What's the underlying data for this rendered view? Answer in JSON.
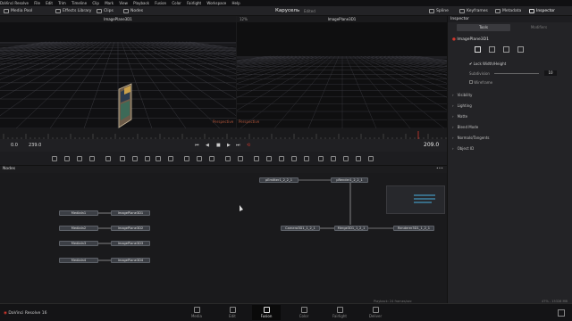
{
  "menubar": [
    "DaVinci Resolve",
    "File",
    "Edit",
    "Trim",
    "Timeline",
    "Clip",
    "Mark",
    "View",
    "Playback",
    "Fusion",
    "Color",
    "Fairlight",
    "Workspace",
    "Help"
  ],
  "toolbar": {
    "media_pool": "Media Pool",
    "effects_library": "Effects Library",
    "clips": "Clips",
    "nodes": "Nodes",
    "project_title": "Карусель",
    "project_status": "Edited",
    "spline": "Spline",
    "keyframes": "Keyframes",
    "metadata": "Metadata",
    "inspector": "Inspector"
  },
  "viewer_left": {
    "title": "ImagePlane3D1",
    "zoom": "",
    "view_label": "Perspective"
  },
  "viewer_right": {
    "title": "ImagePlane3D1",
    "zoom": "12%",
    "view_label": "Perspective"
  },
  "transport": {
    "start": "0.0",
    "end": "239.0",
    "current": "209.0"
  },
  "nodes_panel": {
    "title": "Nodes",
    "nodes": [
      {
        "id": "media1",
        "label": "MediaIn1"
      },
      {
        "id": "media2",
        "label": "MediaIn2"
      },
      {
        "id": "media3",
        "label": "MediaIn3"
      },
      {
        "id": "media4",
        "label": "MediaIn4"
      },
      {
        "id": "ip1",
        "label": "ImagePlane3D1"
      },
      {
        "id": "ip2",
        "label": "ImagePlane3D2"
      },
      {
        "id": "ip3",
        "label": "ImagePlane3D3"
      },
      {
        "id": "ip4",
        "label": "ImagePlane3D4"
      },
      {
        "id": "pem1",
        "label": "pEmitter1_2_2_1"
      },
      {
        "id": "prend",
        "label": "pRender1_2_2_1"
      },
      {
        "id": "cam",
        "label": "Camera3D1_1_2_1"
      },
      {
        "id": "merge",
        "label": "Merge3D1_1_2_1"
      },
      {
        "id": "renderer",
        "label": "Renderer3D1_1_2_1"
      }
    ]
  },
  "inspector": {
    "node_title": "ImagePlane3D1",
    "tabs": [
      "Tools",
      "Modifiers"
    ],
    "lock_label": "Lock Width/Height",
    "subdivision_label": "Subdivision",
    "subdivision_value": "10",
    "wireframe_label": "Wireframe",
    "sections": [
      "Visibility",
      "Lighting",
      "Matte",
      "Blend Mode",
      "Normals/Tangents",
      "Object ID"
    ]
  },
  "status": {
    "app_name": "DaVinci Resolve 16",
    "playback": "Playback: 24 frames/sec",
    "memory": "47% - 15328 MB"
  },
  "pages": [
    {
      "label": "Media",
      "icon": "media-icon"
    },
    {
      "label": "Edit",
      "icon": "edit-icon"
    },
    {
      "label": "Fusion",
      "icon": "fusion-icon",
      "active": true
    },
    {
      "label": "Color",
      "icon": "color-icon"
    },
    {
      "label": "Fairlight",
      "icon": "fairlight-icon"
    },
    {
      "label": "Deliver",
      "icon": "deliver-icon"
    }
  ],
  "colors": {
    "accent": "#d0372d",
    "grid": "#3a3a40",
    "background": "#1c1c1e",
    "node": "#3c3f45"
  }
}
